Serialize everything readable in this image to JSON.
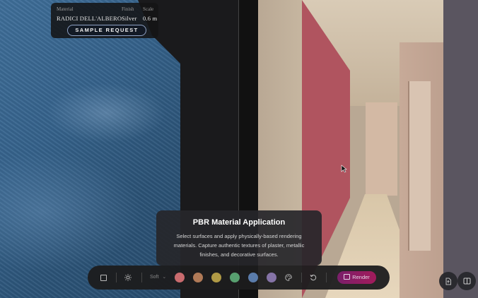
{
  "material_info": {
    "material_label": "Material",
    "material_value": "RADICI DELL'ALBERO",
    "finish_label": "Finish",
    "finish_value": "Silver",
    "scale_label": "Scale",
    "scale_value": "0.6 m",
    "sample_request_label": "SAMPLE REQUEST"
  },
  "tooltip": {
    "title": "PBR Material Application",
    "body": "Select surfaces and apply physically-based rendering materials. Capture authentic textures of plaster, metallic finishes, and decorative surfaces."
  },
  "toolbar": {
    "soft_label": "Soft",
    "render_label": "Render",
    "swatches": [
      "#c96b6e",
      "#b07a57",
      "#b09a45",
      "#58a070",
      "#5a7cab",
      "#8573a6"
    ],
    "icons": [
      "square-icon",
      "sun-icon",
      "chevron-down-icon",
      "palette-icon",
      "reset-icon",
      "image-icon"
    ]
  },
  "side_buttons": {
    "icons": [
      "export-icon",
      "split-view-icon"
    ]
  }
}
